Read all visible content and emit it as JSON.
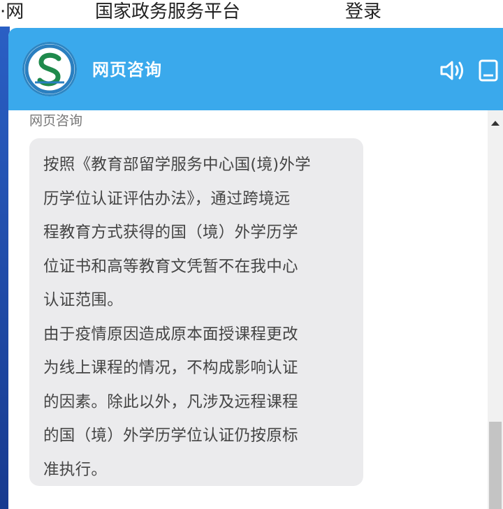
{
  "nav": {
    "site_fragment": "·网",
    "gov_platform": "国家政务服务平台",
    "login": "登录"
  },
  "chat": {
    "header_title": "网页咨询",
    "sender_label": "网页咨询",
    "message": [
      "按照《教育部留学服务中心国(境)外学",
      "历学位认证评估办法》，通过跨境远",
      "程教育方式获得的国（境）外学历学",
      "位证书和高等教育文凭暂不在我中心",
      "认证范围。",
      "由于疫情原因造成原本面授课程更改",
      "为线上课程的情况，不构成影响认证",
      "的因素。除此以外，凡涉及远程课程",
      "的国（境）外学历学位认证仍按原标",
      "准执行。"
    ]
  },
  "icons": {
    "logo": "service-center-logo",
    "speaker": "speaker-icon",
    "minimize": "minimize-icon",
    "scroll_up": "scroll-up-arrow-icon"
  },
  "colors": {
    "header": "#3aa9ec",
    "bubble": "#ebebed",
    "page_strip": "#2a5fc4"
  }
}
